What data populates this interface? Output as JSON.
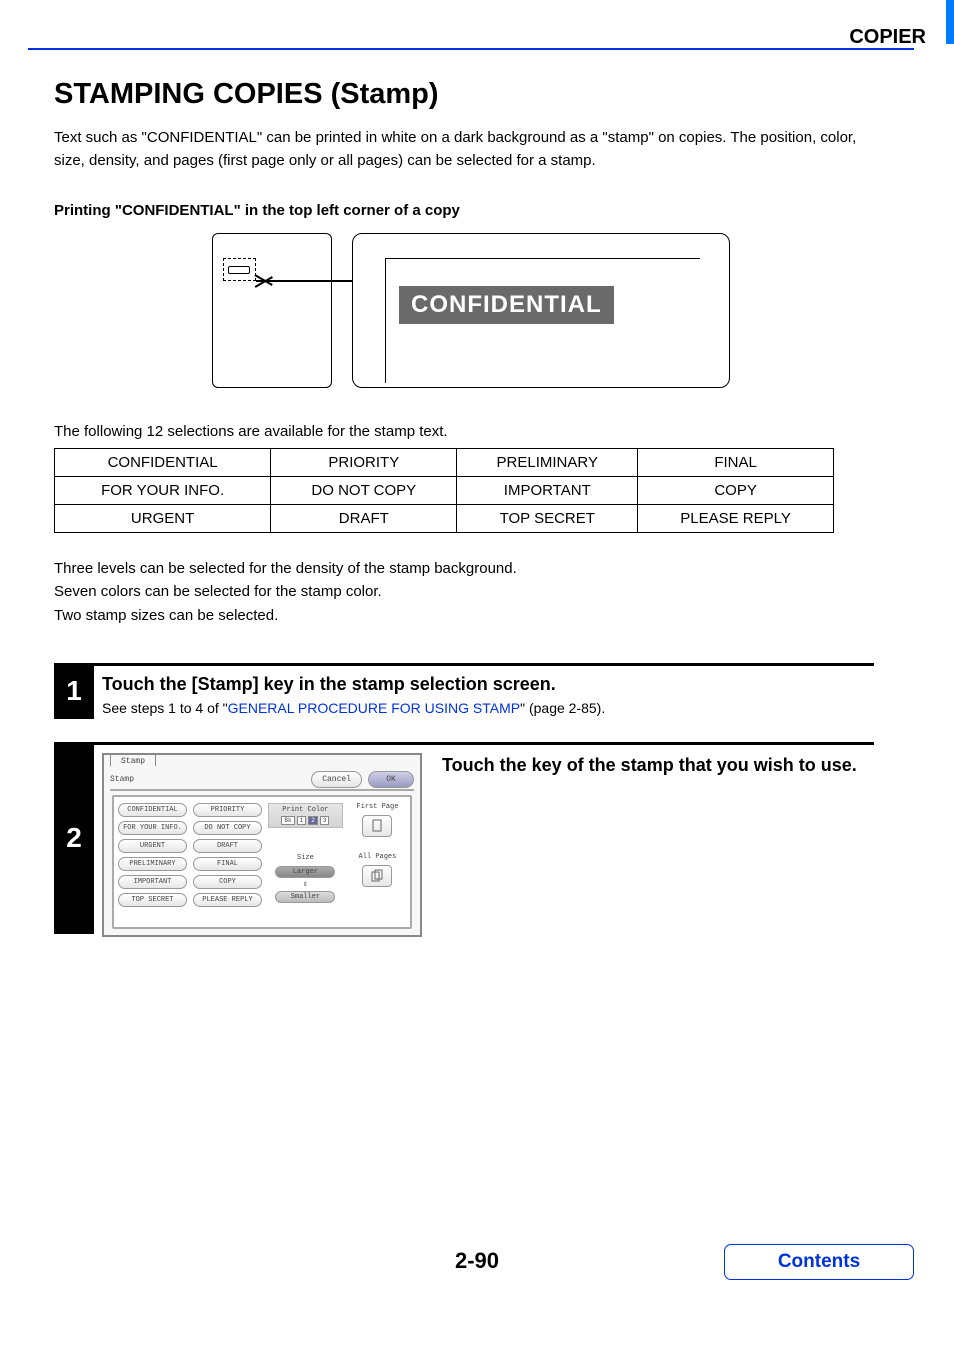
{
  "header": {
    "section": "COPIER"
  },
  "title": "STAMPING COPIES (Stamp)",
  "intro": "Text such as \"CONFIDENTIAL\" can be printed in white on a dark background as a \"stamp\" on copies. The position, color, size, density, and pages (first page only or all pages) can be selected for a stamp.",
  "example_heading": "Printing \"CONFIDENTIAL\" in the top left corner of a copy",
  "illustration": {
    "stamp_label": "CONFIDENTIAL"
  },
  "table_intro": "The following 12 selections are available for the stamp text.",
  "stamp_texts": [
    [
      "CONFIDENTIAL",
      "PRIORITY",
      "PRELIMINARY",
      "FINAL"
    ],
    [
      "FOR YOUR INFO.",
      "DO NOT COPY",
      "IMPORTANT",
      "COPY"
    ],
    [
      "URGENT",
      "DRAFT",
      "TOP SECRET",
      "PLEASE REPLY"
    ]
  ],
  "info_lines": {
    "l1": "Three levels can be selected for the density of the stamp background.",
    "l2": "Seven colors can be selected for the stamp color.",
    "l3": "Two stamp sizes can be selected."
  },
  "step1": {
    "num": "1",
    "title": "Touch the [Stamp] key in the stamp selection screen.",
    "pre": "See steps 1 to 4 of \"",
    "link": "GENERAL PROCEDURE FOR USING STAMP",
    "post": "\" (page 2-85)."
  },
  "step2": {
    "num": "2",
    "title": "Touch the key of the stamp that you wish to use.",
    "screen": {
      "tab": "Stamp",
      "subtitle": "Stamp",
      "cancel": "Cancel",
      "ok": "OK",
      "left_col": [
        "CONFIDENTIAL",
        "FOR YOUR INFO.",
        "URGENT",
        "PRELIMINARY",
        "IMPORTANT",
        "TOP SECRET"
      ],
      "right_col": [
        "PRIORITY",
        "DO NOT COPY",
        "DRAFT",
        "FINAL",
        "COPY",
        "PLEASE REPLY"
      ],
      "print_color": "Print Color",
      "color_bk": "Bk",
      "color_1": "1",
      "color_sel": "2",
      "color_3": "3",
      "size_label": "Size",
      "larger": "Larger",
      "smaller": "Smaller",
      "first_page": "First Page",
      "all_pages": "All Pages"
    }
  },
  "footer": {
    "page_number": "2-90",
    "contents": "Contents"
  }
}
